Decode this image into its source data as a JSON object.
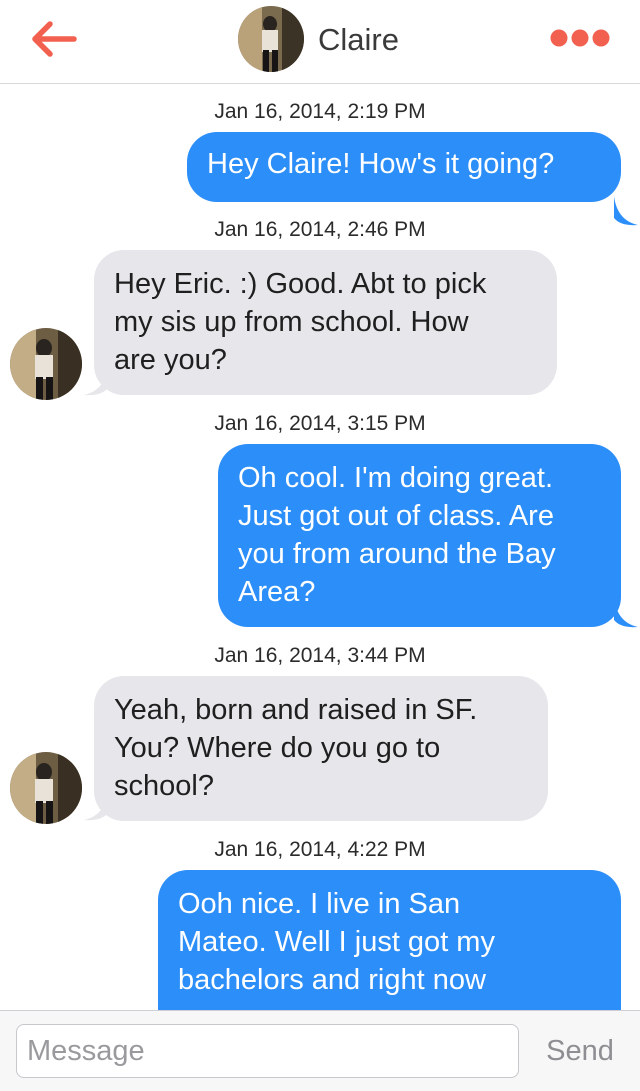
{
  "header": {
    "back_icon": "back-arrow-icon",
    "contact_name": "Claire",
    "more_icon": "more-dots-icon",
    "accent_color": "#f2614f"
  },
  "messages": [
    {
      "timestamp": "Jan 16, 2014, 2:19 PM",
      "direction": "outgoing",
      "lines": [
        "Hey Claire! How's it going?"
      ]
    },
    {
      "timestamp": "Jan 16, 2014, 2:46 PM",
      "direction": "incoming",
      "lines": [
        "Hey Eric. :) Good. Abt to pick",
        "my sis up from school. How",
        "are you?"
      ]
    },
    {
      "timestamp": "Jan 16, 2014, 3:15 PM",
      "direction": "outgoing",
      "lines": [
        "Oh cool. I'm doing great.",
        "Just got out of class. Are",
        "you from around the Bay",
        "Area?"
      ]
    },
    {
      "timestamp": "Jan 16, 2014, 3:44 PM",
      "direction": "incoming",
      "lines": [
        "Yeah, born and raised in SF.",
        "You? Where do you go to",
        "school?"
      ]
    },
    {
      "timestamp": "Jan 16, 2014, 4:22 PM",
      "direction": "outgoing",
      "lines": [
        "Ooh nice. I live in San",
        "Mateo. Well I just got my",
        "bachelors and right now"
      ]
    }
  ],
  "composer": {
    "placeholder": "Message",
    "value": "",
    "send_label": "Send"
  },
  "colors": {
    "outgoing_bubble": "#2c8ef8",
    "incoming_bubble": "#e6e6eb"
  }
}
